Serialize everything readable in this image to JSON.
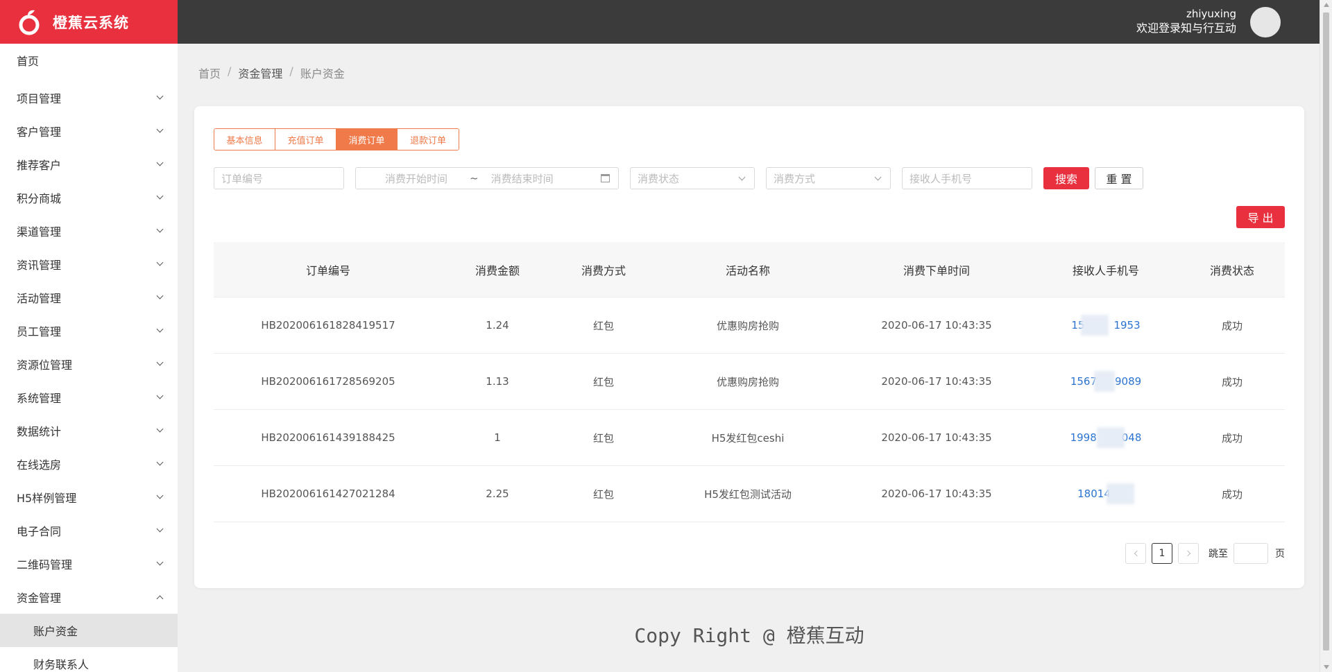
{
  "app": {
    "title": "橙蕉云系统",
    "brand_color": "#e8303f",
    "accent_color": "#f07a4a"
  },
  "user": {
    "name": "zhiyuxing",
    "welcome": "欢迎登录知与行互动"
  },
  "sidebar": {
    "home": "首页",
    "items": [
      {
        "label": "项目管理"
      },
      {
        "label": "客户管理"
      },
      {
        "label": "推荐客户"
      },
      {
        "label": "积分商城"
      },
      {
        "label": "渠道管理"
      },
      {
        "label": "资讯管理"
      },
      {
        "label": "活动管理"
      },
      {
        "label": "员工管理"
      },
      {
        "label": "资源位管理"
      },
      {
        "label": "系统管理"
      },
      {
        "label": "数据统计"
      },
      {
        "label": "在线选房"
      },
      {
        "label": "H5样例管理"
      },
      {
        "label": "电子合同"
      },
      {
        "label": "二维码管理"
      }
    ],
    "open_group": {
      "label": "资金管理",
      "children": [
        "账户资金",
        "财务联系人"
      ]
    }
  },
  "breadcrumb": {
    "home": "首页",
    "section": "资金管理",
    "current": "账户资金"
  },
  "tabs": [
    "基本信息",
    "充值订单",
    "消费订单",
    "退款订单"
  ],
  "filters": {
    "order_no_placeholder": "订单编号",
    "start_time_placeholder": "消费开始时间",
    "range_sep": "~",
    "end_time_placeholder": "消费结束时间",
    "status_placeholder": "消费状态",
    "method_placeholder": "消费方式",
    "phone_placeholder": "接收人手机号",
    "search_label": "搜索",
    "reset_label": "重 置"
  },
  "export_label": "导 出",
  "table": {
    "headers": [
      "订单编号",
      "消费金额",
      "消费方式",
      "活动名称",
      "消费下单时间",
      "接收人手机号",
      "消费状态"
    ],
    "rows": [
      {
        "order": "HB202006161828419517",
        "amount": "1.24",
        "method": "红包",
        "activity": "优惠购房抢购",
        "time": "2020-06-17 10:43:35",
        "phone": "15",
        "phone_end": "1953",
        "status": "成功"
      },
      {
        "order": "HB202006161728569205",
        "amount": "1.13",
        "method": "红包",
        "activity": "优惠购房抢购",
        "time": "2020-06-17 10:43:35",
        "phone": "1567",
        "phone_end": "9089",
        "status": "成功"
      },
      {
        "order": "HB202006161439188425",
        "amount": "1",
        "method": "红包",
        "activity": "H5发红包ceshi",
        "time": "2020-06-17 10:43:35",
        "phone": "1998",
        "phone_end": "048",
        "status": "成功"
      },
      {
        "order": "HB202006161427021284",
        "amount": "2.25",
        "method": "红包",
        "activity": "H5发红包测试活动",
        "time": "2020-06-17 10:43:35",
        "phone": "18014",
        "phone_end": "",
        "status": "成功"
      }
    ]
  },
  "pagination": {
    "current_page": "1",
    "jump_label": "跳至",
    "page_suffix": "页"
  },
  "footer": "Copy Right @ 橙蕉互动"
}
